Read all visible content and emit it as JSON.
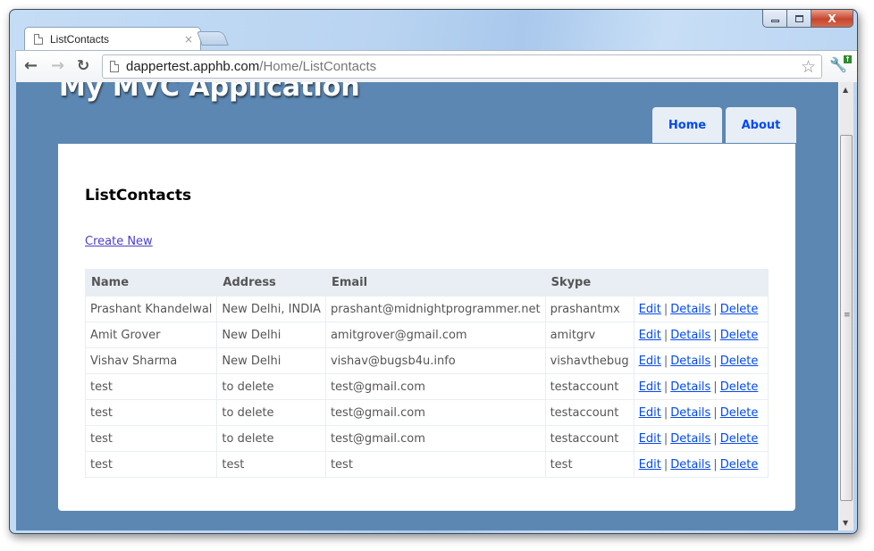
{
  "browser": {
    "tab_title": "ListContacts",
    "tab_close": "×",
    "url_host": "dappertest.apphb.com",
    "url_path": "/Home/ListContacts",
    "window_close": "X"
  },
  "site": {
    "title": "My MVC Application",
    "menu": [
      {
        "label": "Home"
      },
      {
        "label": "About"
      }
    ]
  },
  "page": {
    "heading": "ListContacts",
    "create_new": "Create New"
  },
  "table": {
    "headers": [
      "Name",
      "Address",
      "Email",
      "Skype",
      ""
    ],
    "actions": {
      "edit": "Edit",
      "details": "Details",
      "delete": "Delete",
      "separator": "|"
    },
    "rows": [
      {
        "name": "Prashant Khandelwal",
        "address": "New Delhi, INDIA",
        "email": "prashant@midnightprogrammer.net",
        "skype": "prashantmx"
      },
      {
        "name": "Amit Grover",
        "address": "New Delhi",
        "email": "amitgrover@gmail.com",
        "skype": "amitgrv"
      },
      {
        "name": "Vishav Sharma",
        "address": "New Delhi",
        "email": "vishav@bugsb4u.info",
        "skype": "vishavthebug"
      },
      {
        "name": "test",
        "address": "to delete",
        "email": "test@gmail.com",
        "skype": "testaccount"
      },
      {
        "name": "test",
        "address": "to delete",
        "email": "test@gmail.com",
        "skype": "testaccount"
      },
      {
        "name": "test",
        "address": "to delete",
        "email": "test@gmail.com",
        "skype": "testaccount"
      },
      {
        "name": "test",
        "address": "test",
        "email": "test",
        "skype": "test"
      }
    ]
  },
  "colors": {
    "page_background": "#5c87b2",
    "menu_background": "#e8eef6",
    "link_blue": "#034af3",
    "header_row": "#e8eef4"
  }
}
